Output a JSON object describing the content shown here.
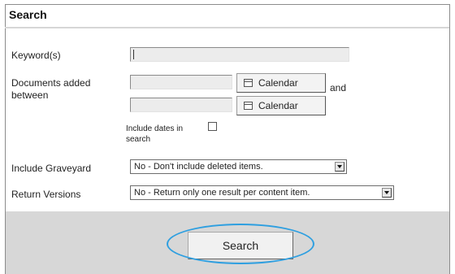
{
  "panel": {
    "title": "Search"
  },
  "keyword": {
    "label": "Keyword(s)",
    "value": ""
  },
  "dates": {
    "label_line1": "Documents added",
    "label_line2": "between",
    "from_value": "",
    "to_value": "",
    "calendar_label": "Calendar",
    "and_text": "and",
    "include_label_line1": "Include dates in",
    "include_label_line2": "search",
    "include_checked": false
  },
  "graveyard": {
    "label": "Include Graveyard",
    "selected": "No - Don't include deleted items."
  },
  "versions": {
    "label": "Return Versions",
    "selected": "No - Return only one result per content item."
  },
  "footer": {
    "search_button": "Search"
  },
  "colors": {
    "highlight": "#2e9fe0",
    "footer_bg": "#d7d7d7"
  }
}
